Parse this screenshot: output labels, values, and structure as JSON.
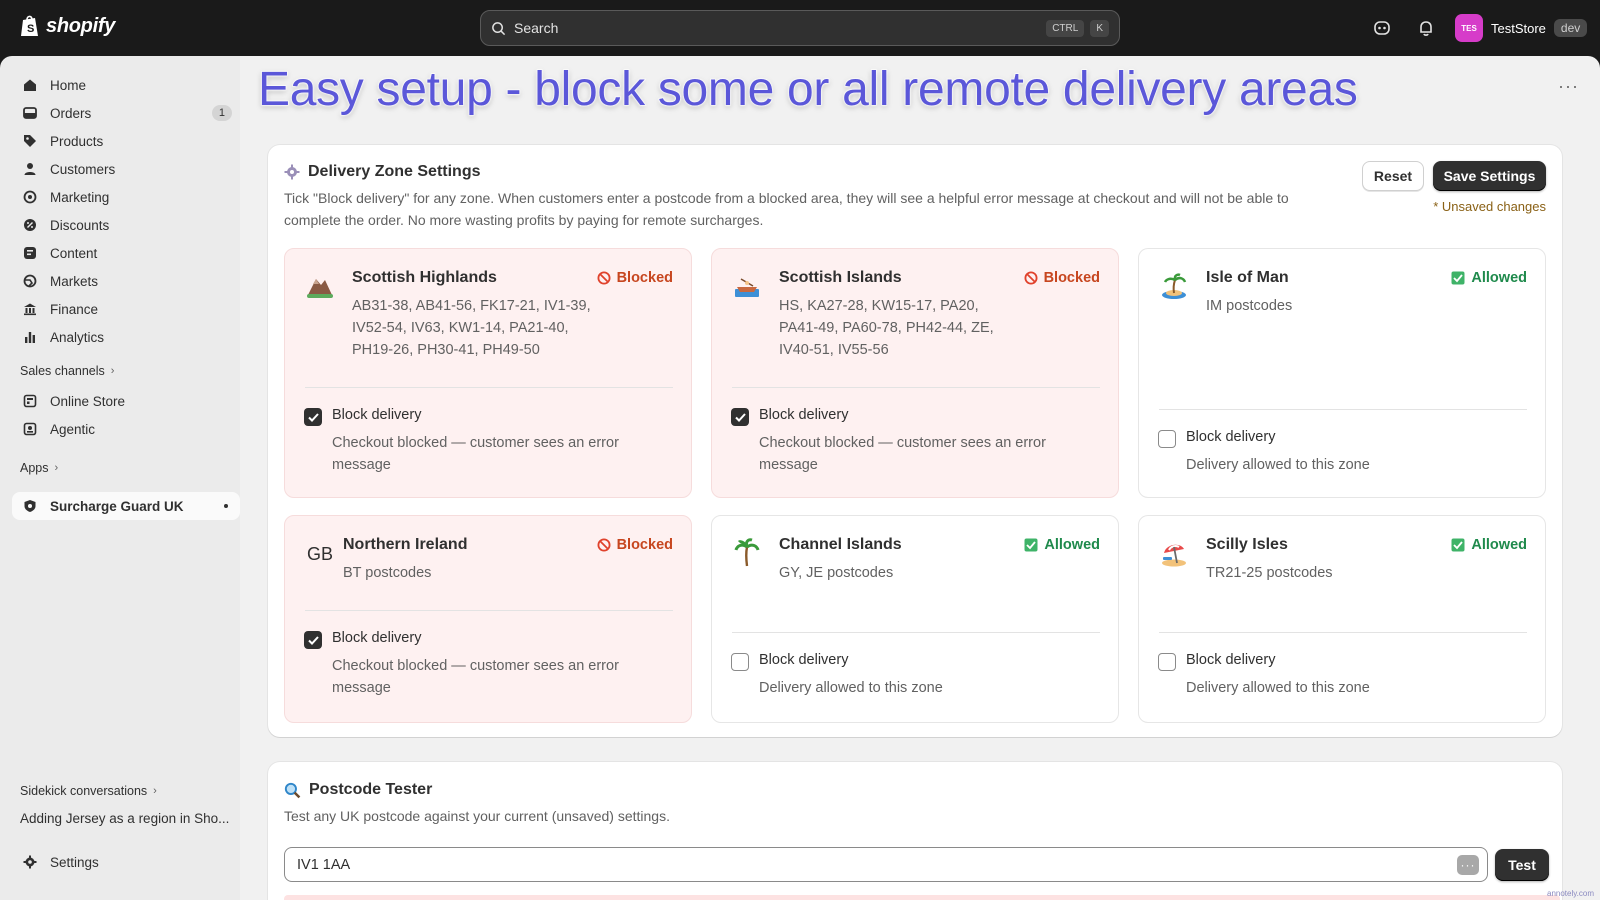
{
  "topbar": {
    "brand": "shopify",
    "search_placeholder": "Search",
    "shortcut_ctrl": "CTRL",
    "shortcut_k": "K",
    "store_initials": "TES",
    "store_name": "TestStore",
    "store_badge": "dev"
  },
  "sidebar": {
    "items": [
      {
        "label": "Home",
        "icon": "home-icon"
      },
      {
        "label": "Orders",
        "icon": "orders-icon",
        "count": "1"
      },
      {
        "label": "Products",
        "icon": "tag-icon"
      },
      {
        "label": "Customers",
        "icon": "person-icon"
      },
      {
        "label": "Marketing",
        "icon": "target-icon"
      },
      {
        "label": "Discounts",
        "icon": "discount-icon"
      },
      {
        "label": "Content",
        "icon": "content-icon"
      },
      {
        "label": "Markets",
        "icon": "globe-icon"
      },
      {
        "label": "Finance",
        "icon": "bank-icon"
      },
      {
        "label": "Analytics",
        "icon": "bar-chart-icon"
      }
    ],
    "sales_channels_label": "Sales channels",
    "channels": [
      {
        "label": "Online Store",
        "icon": "store-icon"
      },
      {
        "label": "Agentic",
        "icon": "agent-icon"
      }
    ],
    "apps_label": "Apps",
    "app_active": "Surcharge Guard UK",
    "sidekick_label": "Sidekick conversations",
    "sidekick_item": "Adding Jersey as a region in Sho...",
    "settings_label": "Settings"
  },
  "overlay_title": "Easy setup - block some or all remote delivery areas",
  "settings_card": {
    "title": "Delivery Zone Settings",
    "description": "Tick \"Block delivery\" for any zone. When customers enter a postcode from a blocked area, they will see a helpful error message at checkout and will not be able to complete the order. No more wasting profits by paying for remote surcharges.",
    "reset_label": "Reset",
    "save_label": "Save Settings",
    "unsaved_label": "* Unsaved changes"
  },
  "block_label": "Block delivery",
  "zones": [
    {
      "name": "Scottish Highlands",
      "emoji": "⛰️",
      "codes": "AB31-38, AB41-56, FK17-21, IV1-39, IV52-54, IV63, KW1-14, PA21-40, PH19-26, PH30-41, PH49-50",
      "status": "Blocked",
      "blocked": true,
      "note": "Checkout blocked — customer sees an error message"
    },
    {
      "name": "Scottish Islands",
      "emoji": "🚣",
      "codes": "HS, KA27-28, KW15-17, PA20, PA41-49, PA60-78, PH42-44, ZE, IV40-51, IV55-56",
      "status": "Blocked",
      "blocked": true,
      "note": "Checkout blocked — customer sees an error message"
    },
    {
      "name": "Isle of Man",
      "emoji": "🏝️",
      "codes": "IM postcodes",
      "status": "Allowed",
      "blocked": false,
      "note": "Delivery allowed to this zone"
    },
    {
      "name": "Northern Ireland",
      "emoji": "GB",
      "codes": "BT postcodes",
      "status": "Blocked",
      "blocked": true,
      "note": "Checkout blocked — customer sees an error message"
    },
    {
      "name": "Channel Islands",
      "emoji": "🌴",
      "codes": "GY, JE postcodes",
      "status": "Allowed",
      "blocked": false,
      "note": "Delivery allowed to this zone"
    },
    {
      "name": "Scilly Isles",
      "emoji": "🏖️",
      "codes": "TR21-25 postcodes",
      "status": "Allowed",
      "blocked": false,
      "note": "Delivery allowed to this zone"
    }
  ],
  "tester": {
    "title": "Postcode Tester",
    "description": "Test any UK postcode against your current (unsaved) settings.",
    "input_value": "IV1 1AA",
    "test_label": "Test"
  },
  "colors": {
    "accent_title": "#5b57d9",
    "blocked": "#c7461f",
    "allowed": "#1f8a4c",
    "blocked_bg": "#fef1f1"
  },
  "watermark": "annotely.com"
}
